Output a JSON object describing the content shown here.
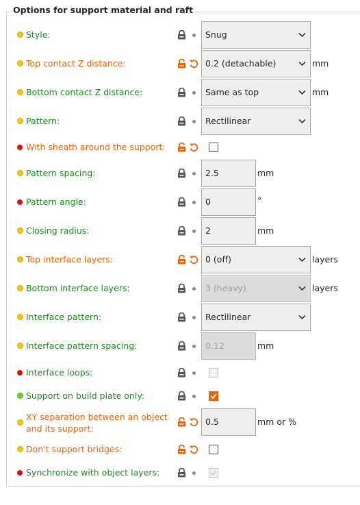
{
  "group": {
    "title": "Options for support material and raft"
  },
  "rows": [
    {
      "label": "Style:",
      "value": "Snug"
    },
    {
      "label": "Top contact Z distance:",
      "value": "0.2 (detachable)",
      "unit": "mm"
    },
    {
      "label": "Bottom contact Z distance:",
      "value": "Same as top",
      "unit": "mm"
    },
    {
      "label": "Pattern:",
      "value": "Rectilinear"
    },
    {
      "label": "With sheath around the support:"
    },
    {
      "label": "Pattern spacing:",
      "value": "2.5",
      "unit": "mm"
    },
    {
      "label": "Pattern angle:",
      "value": "0",
      "unit": "°"
    },
    {
      "label": "Closing radius:",
      "value": "2",
      "unit": "mm"
    },
    {
      "label": "Top interface layers:",
      "value": "0 (off)",
      "unit": "layers"
    },
    {
      "label": "Bottom interface layers:",
      "value": "3 (heavy)",
      "unit": "layers"
    },
    {
      "label": "Interface pattern:",
      "value": "Rectilinear"
    },
    {
      "label": "Interface pattern spacing:",
      "value": "0.12",
      "unit": "mm"
    },
    {
      "label": "Interface loops:"
    },
    {
      "label": "Support on build plate only:"
    },
    {
      "label": "XY separation between an object and its support:",
      "label_line1": "XY separation between an object",
      "label_line2": "and its support:",
      "value": "0.5",
      "unit": "mm or %"
    },
    {
      "label": "Don't support bridges:"
    },
    {
      "label": "Synchronize with object layers:"
    }
  ],
  "colors": {
    "system_label": "#1f8a21",
    "modified_label": "#e8640b",
    "bullet_simple": "#f6c60f",
    "bullet_advanced": "#e00d0d",
    "bullet_basic": "#6fd136"
  }
}
